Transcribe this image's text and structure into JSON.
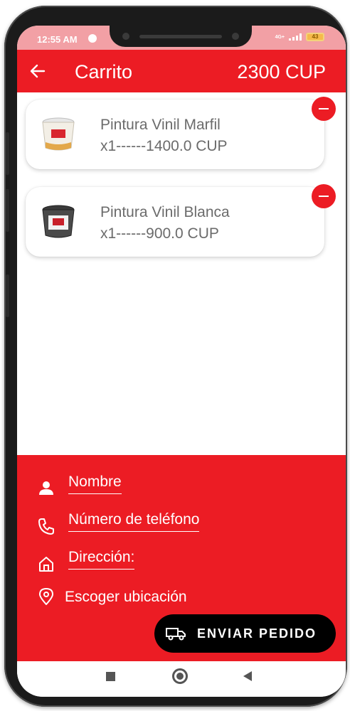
{
  "status": {
    "time": "12:55 AM",
    "network": "4G+",
    "battery": "43"
  },
  "appbar": {
    "title": "Carrito",
    "total": "2300 CUP"
  },
  "cart": [
    {
      "name": "Pintura Vinil Marfil",
      "detail": "x1------1400.0 CUP"
    },
    {
      "name": "Pintura Vinil Blanca",
      "detail": "x1------900.0 CUP"
    }
  ],
  "form": {
    "name_label": "Nombre",
    "phone_label": "Número de teléfono",
    "address_label": "Dirección:",
    "location_label": "Escoger ubicación"
  },
  "send_button": {
    "label": "ENVIAR PEDIDO"
  },
  "icons": {
    "back": "arrow-left-icon",
    "remove": "minus-circle-icon",
    "person": "person-icon",
    "phone": "phone-icon",
    "home": "home-icon",
    "location": "location-pin-icon",
    "truck": "truck-icon"
  },
  "colors": {
    "primary": "#ec1c24",
    "button": "#000000",
    "text_muted": "#6b6b6b"
  }
}
